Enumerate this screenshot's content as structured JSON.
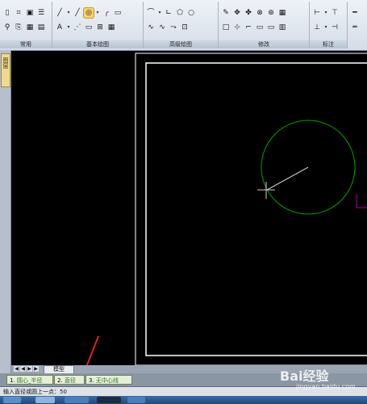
{
  "ribbon": {
    "panels": [
      {
        "title": "常用",
        "row1": [
          "▯",
          "⌗",
          "▣",
          "☰"
        ],
        "row2": [
          "⚲",
          "⎘",
          "▦",
          "▤"
        ]
      },
      {
        "title": "基本绘图",
        "row1": [
          "╱",
          "╱",
          "◎",
          "╭",
          "▭"
        ],
        "row2": [
          "A",
          "⋰",
          "▭",
          "⊞",
          "▦"
        ]
      },
      {
        "title": "高级绘图",
        "row1": [
          "⌒",
          "∟",
          "⬠",
          "○"
        ],
        "row2": [
          "∿",
          "∿",
          "⤳",
          "⊡"
        ]
      },
      {
        "title": "修改",
        "row1": [
          "✎",
          "✥",
          "✤",
          "⊗",
          "⊛",
          "▦"
        ],
        "row2": [
          "□",
          "⊹",
          "⌐",
          "▭",
          "▭",
          "▥"
        ]
      },
      {
        "title": "标注",
        "row1": [
          "⊢",
          "⊤"
        ],
        "row2": [
          "⊥",
          "⊣"
        ]
      }
    ],
    "partial_row1": "━",
    "partial_row2": "═"
  },
  "dock": {
    "tab_label": "图层"
  },
  "tabs": {
    "nav": [
      "◀",
      "◀",
      "▶",
      "▶"
    ],
    "model": "模型"
  },
  "options": [
    {
      "num": "1.",
      "label": "圆心_半径"
    },
    {
      "num": "2.",
      "label": "直径"
    },
    {
      "num": "3.",
      "label": "无中心线"
    }
  ],
  "command": {
    "prompt": "输入直径或圆上一点：50"
  },
  "colors": {
    "circle": "#00a000",
    "frame": "#ffffff",
    "ucs": "#a000a0",
    "annotation_arrow": "#e02020"
  },
  "watermark": {
    "brand": "Bai经验",
    "url": "jingyan.baidu.com"
  }
}
